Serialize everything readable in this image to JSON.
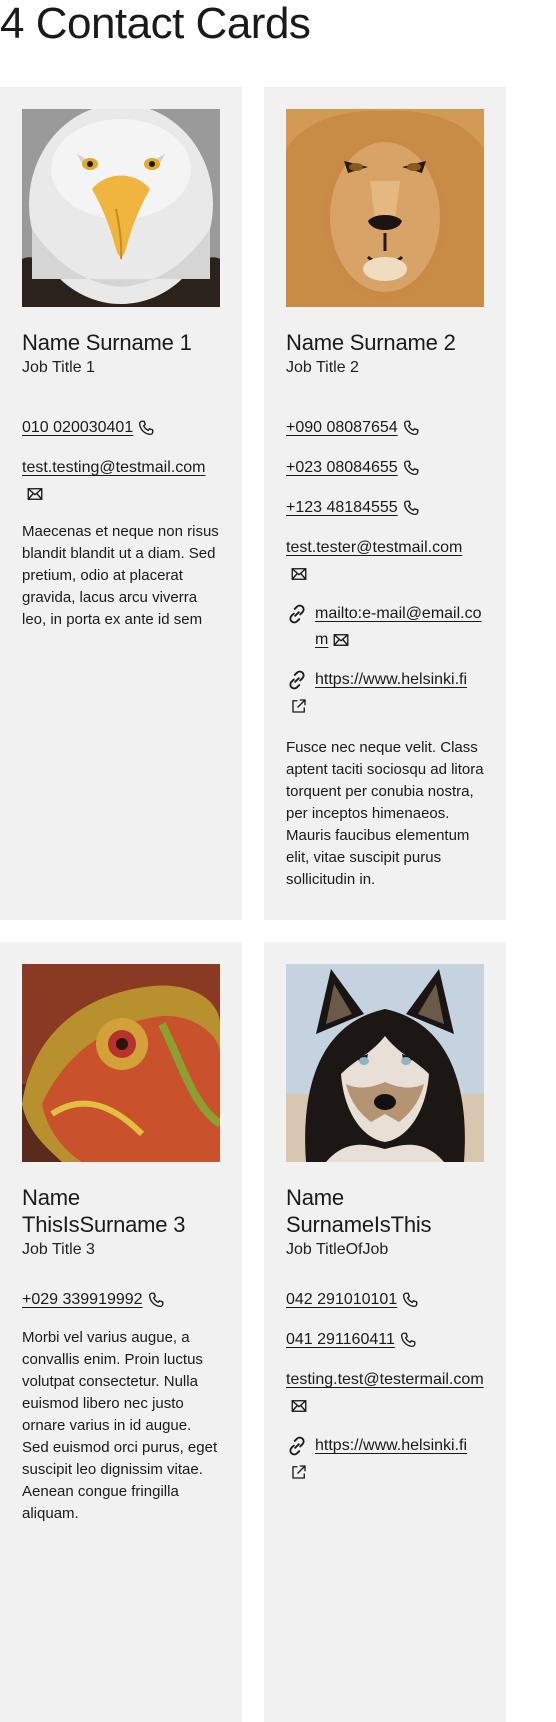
{
  "page": {
    "title": "4 Contact Cards"
  },
  "cards": [
    {
      "name": "Name Surname 1",
      "job": "Job Title 1",
      "photo_icon": "eagle-photo",
      "phones": [
        "010 020030401"
      ],
      "emails": [
        "test.testing@testmail.com"
      ],
      "description": "Maecenas et neque non risus blandit blandit ut a diam. Sed pretium, odio at placerat gravida, lacus arcu viverra leo, in porta ex ante id sem"
    },
    {
      "name": "Name Surname 2",
      "job": "Job Title 2",
      "photo_icon": "lion-photo",
      "phones": [
        "+090 08087654",
        "+023 08084655",
        "+123 48184555"
      ],
      "emails": [
        "test.tester@testmail.com"
      ],
      "links": [
        "mailto:e-mail@email.com",
        "https://www.helsinki.fi"
      ],
      "description": "Fusce nec neque velit. Class aptent taciti sociosqu ad litora torquent per conubia nostra, per inceptos himenaeos. Mauris faucibus elementum elit, vitae suscipit purus sollicitudin in."
    },
    {
      "name": "Name ThisIsSurname 3",
      "job": "Job Title 3",
      "photo_icon": "chameleon-photo",
      "phones": [
        "+029 339919992"
      ],
      "description": "Morbi vel varius augue, a convallis enim. Proin luctus volutpat consectetur. Nulla euismod libero nec justo ornare varius in id augue. Sed euismod orci purus, eget suscipit leo dignissim vitae. Aenean congue fringilla aliquam."
    },
    {
      "name": "Name SurnameIsThis",
      "job": "Job TitleOfJob",
      "photo_icon": "husky-photo",
      "phones": [
        "042 291010101",
        "041 291160411"
      ],
      "emails": [
        "testing.test@testermail.com"
      ],
      "links": [
        "https://www.helsinki.fi"
      ]
    }
  ],
  "colors": {
    "card_bg": "#f1f1f1",
    "text": "#1a1a1a"
  }
}
